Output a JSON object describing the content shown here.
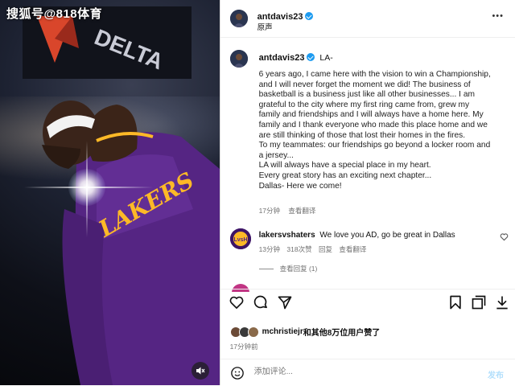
{
  "photo": {
    "watermark": "搜狐号@818体育",
    "arena_sign": "DELTA",
    "jersey_text": "LAKERS",
    "sound_icon": "speaker-muted-icon"
  },
  "post": {
    "username": "antdavis23",
    "header_sub": "原声",
    "more_icon": "more-dots-icon",
    "caption_user": "antdavis23",
    "caption_tag": "LA-",
    "caption_lines": [
      "6 years ago, I came here with the vision to win a Championship,",
      "and I will never forget the moment we did! The business of",
      "basketball is a business just like all other businesses... I am",
      "grateful to the city where my first ring came from, grew my",
      "family and friendships and I will always have a home here. My",
      "family and I thank everyone who made this place home and we",
      "are still thinking of those that lost their homes in the fires.",
      "To my teammates: our friendships go beyond a locker room and",
      "a jersey...",
      "LA will always have a special place in my heart.",
      "Every great story has an exciting next chapter...",
      "Dallas- Here we come!"
    ],
    "caption_time": "17分钟",
    "caption_translate": "查看翻译"
  },
  "comment": {
    "username": "lakersvshaters",
    "text": "We love you AD, go be great in Dallas",
    "time": "13分钟",
    "likes": "318次赞",
    "reply": "回复",
    "translate": "查看翻译",
    "view_replies": "查看回复 (1)",
    "like_icon": "heart-outline-icon"
  },
  "actions": {
    "like": "heart-icon",
    "comment": "comment-icon",
    "share": "send-icon",
    "bookmark": "bookmark-icon",
    "repost": "collection-icon",
    "download": "download-icon"
  },
  "likes": {
    "user": "mchristiejr",
    "rest": "和其他8万位用户赞了"
  },
  "post_time": "17分钟前",
  "add_comment": {
    "placeholder": "添加评论...",
    "post_label": "发布",
    "emoji_icon": "smiley-icon"
  },
  "colors": {
    "lakers_purple": "#552583",
    "lakers_gold": "#FDB927",
    "verified_blue": "#1d9bf0",
    "delta_red": "#d9462b"
  }
}
